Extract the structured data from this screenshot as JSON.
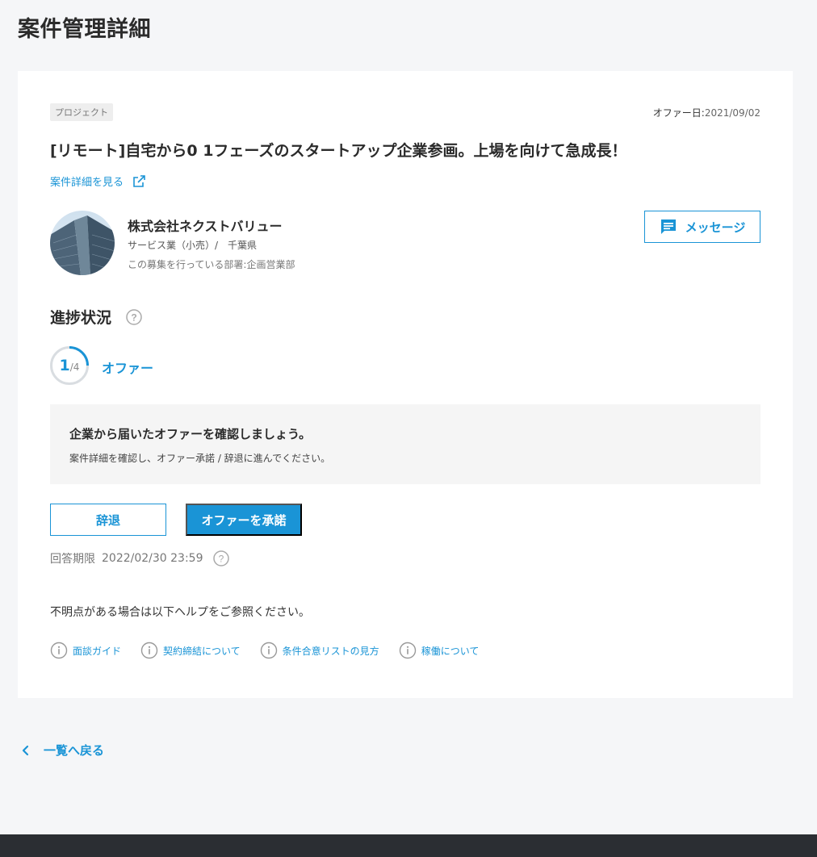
{
  "page": {
    "title": "案件管理詳細"
  },
  "project": {
    "tag": "プロジェクト",
    "offer_date_label": "オファー日:",
    "offer_date": "2021/09/02",
    "title": "[リモート]自宅から0 1フェーズのスタートアップ企業参画。上場を向けて急成長！",
    "detail_link": "案件詳細を見る"
  },
  "company": {
    "name": "株式会社ネクストバリュー",
    "industry_location": "サービス業（小売）/　千葉県",
    "department": "この募集を行っている部署:企画営業部",
    "message_button": "メッセージ"
  },
  "progress": {
    "section_title": "進捗状況",
    "current": "1",
    "total": "/4",
    "fraction": 0.25,
    "stage_label": "オファー"
  },
  "info": {
    "title": "企業から届いたオファーを確認しましょう。",
    "body": "案件詳細を確認し、オファー承諾 / 辞退に進んでください。"
  },
  "actions": {
    "decline": "辞退",
    "accept": "オファーを承諾",
    "deadline_label": "回答期限",
    "deadline_value": "2022/02/30 23:59"
  },
  "help": {
    "text": "不明点がある場合は以下ヘルプをご参照ください。",
    "links": [
      "面談ガイド",
      "契約締結について",
      "条件合意リストの見方",
      "稼働について"
    ]
  },
  "nav": {
    "back": "一覧へ戻る"
  },
  "colors": {
    "accent": "#1a94d6",
    "background": "#f5f6f8",
    "footer": "#2b2e33"
  }
}
